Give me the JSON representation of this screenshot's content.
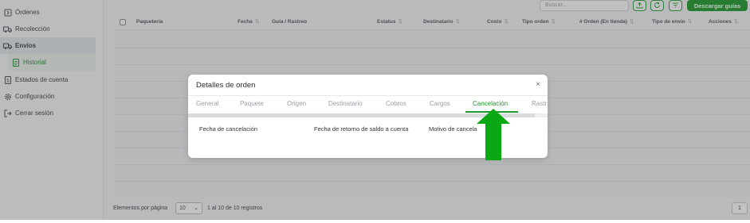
{
  "sidebar": {
    "items": [
      {
        "label": "Órdenes",
        "icon": "orders-icon"
      },
      {
        "label": "Recolección",
        "icon": "pickup-truck-icon"
      },
      {
        "label": "Envíos",
        "icon": "shipping-truck-icon"
      },
      {
        "label": "Historial",
        "icon": "history-doc-icon"
      },
      {
        "label": "Estados de cuenta",
        "icon": "account-statement-icon"
      },
      {
        "label": "Configuración",
        "icon": "gear-icon"
      },
      {
        "label": "Cerrar sesión",
        "icon": "logout-icon"
      }
    ]
  },
  "toolbar": {
    "search_placeholder": "Buscar...",
    "download_label": "Descargar guías"
  },
  "table": {
    "columns": [
      "Paquetería",
      "Fecha",
      "Guía / Rastreo",
      "Estatus",
      "Destinatario",
      "Costo",
      "Tipo orden",
      "# Orden (En tienda)",
      "Tipo de envío",
      "Acciones"
    ]
  },
  "footer": {
    "per_page_label": "Elementos por página",
    "per_page_value": "10",
    "range_info": "1 al 10 de 10 registros",
    "current_page": "1"
  },
  "modal": {
    "title": "Detalles de orden",
    "close": "×",
    "tabs": [
      "General",
      "Paquete",
      "Origen",
      "Destinatario",
      "Cobros",
      "Cargos",
      "Cancelación",
      "Rastr"
    ],
    "active_tab": "Cancelación",
    "fields": [
      "Fecha de cancelación",
      "Fecha de retorno de saldo a cuenta",
      "Motivo de cancela"
    ]
  },
  "colors": {
    "accent": "#1e9a2c",
    "annotation_arrow": "#0aa812"
  }
}
